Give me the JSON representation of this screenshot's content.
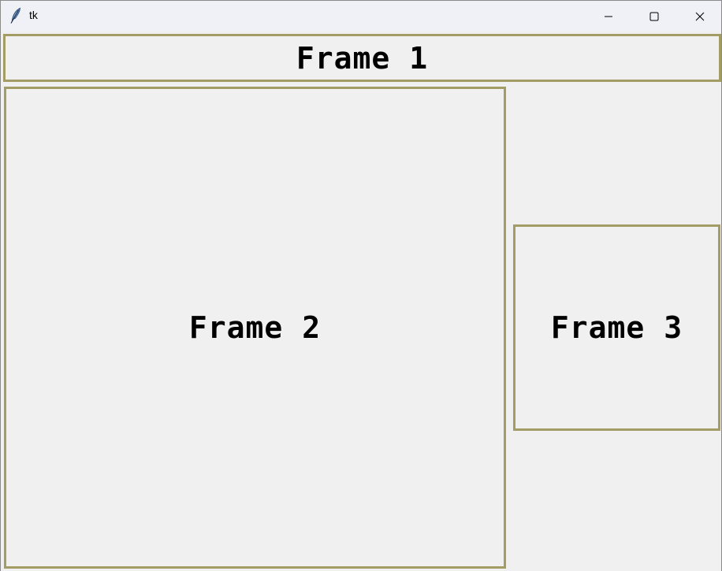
{
  "window": {
    "title": "tk",
    "icon": "feather-icon",
    "controls": [
      "minimize-icon",
      "maximize-icon",
      "close-icon"
    ]
  },
  "frames": [
    {
      "label": "Frame 1"
    },
    {
      "label": "Frame 2"
    },
    {
      "label": "Frame 3"
    }
  ],
  "colors": {
    "frame_border": "#a39c64",
    "background": "#f0f0f0",
    "titlebar": "#eff1f6"
  }
}
